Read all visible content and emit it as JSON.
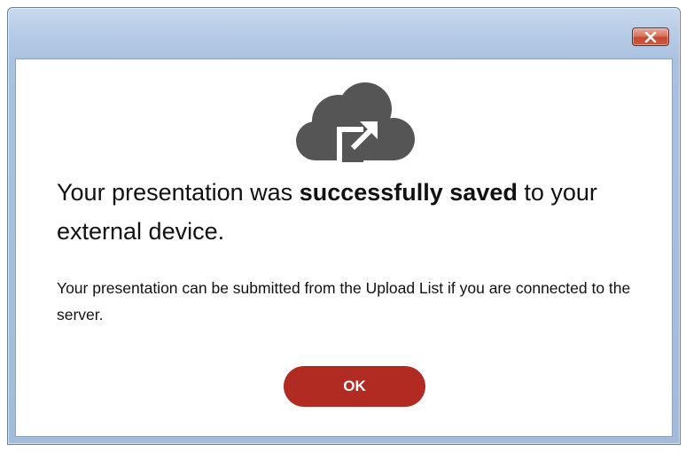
{
  "window": {
    "close_icon": "close-x-icon"
  },
  "dialog": {
    "icon": "cloud-upload-external-icon",
    "headline_prefix": "Your presentation was ",
    "headline_bold": "successfully saved",
    "headline_suffix": " to your external device.",
    "message": "Your presentation can be submitted from the Upload List if you are connected to the server.",
    "ok_label": "OK"
  },
  "colors": {
    "ok_button": "#b22b22",
    "icon": "#555555",
    "close_button": "#c9553b"
  }
}
